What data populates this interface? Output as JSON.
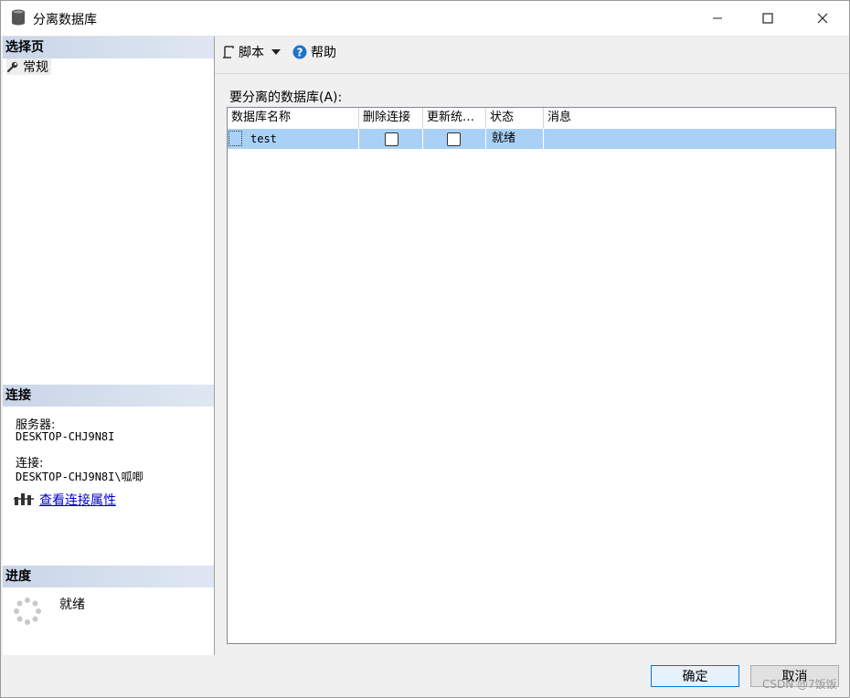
{
  "window": {
    "title": "分离数据库"
  },
  "left": {
    "select_page_title": "选择页",
    "pages": [
      {
        "label": "常规"
      }
    ],
    "connection_title": "连接",
    "server_label": "服务器:",
    "server_value": "DESKTOP-CHJ9N8I",
    "connection_label": "连接:",
    "connection_value": "DESKTOP-CHJ9N8I\\呱唧",
    "view_props_link": "查看连接属性",
    "progress_title": "进度",
    "progress_status": "就绪"
  },
  "toolbar": {
    "script_label": "脚本",
    "help_label": "帮助"
  },
  "main": {
    "grid_label": "要分离的数据库(A):",
    "columns": [
      "数据库名称",
      "删除连接",
      "更新统…",
      "状态",
      "消息"
    ],
    "rows": [
      {
        "name": "test",
        "drop_connections": false,
        "update_stats": false,
        "status": "就绪",
        "message": ""
      }
    ]
  },
  "buttons": {
    "ok": "确定",
    "cancel": "取消"
  },
  "watermark": "CSDN @7饭饭"
}
